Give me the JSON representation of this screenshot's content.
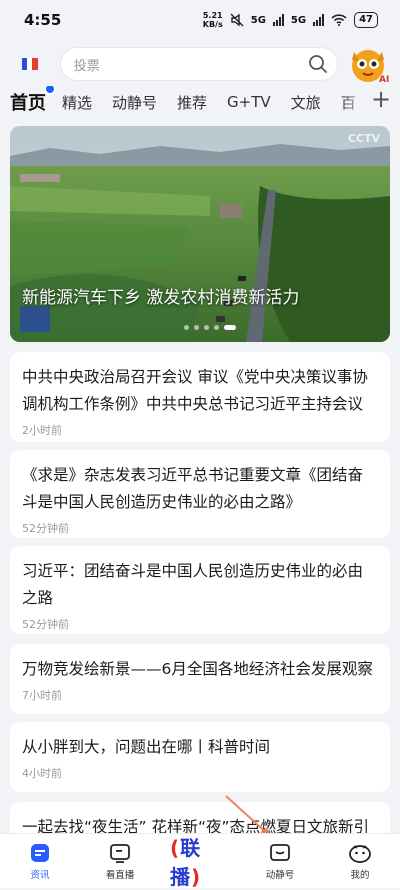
{
  "status_bar": {
    "time": "4:55",
    "net_speed_value": "5.21",
    "net_speed_unit": "KB/s",
    "sig1": "5G",
    "sig2": "5G",
    "battery": "47"
  },
  "header": {
    "search_placeholder": "投票"
  },
  "tabs": [
    {
      "label": "首页"
    },
    {
      "label": "精选"
    },
    {
      "label": "动静号"
    },
    {
      "label": "推荐"
    },
    {
      "label": "G+TV"
    },
    {
      "label": "文旅"
    },
    {
      "label": "百"
    }
  ],
  "hero": {
    "caption": "新能源汽车下乡 激发农村消费新活力",
    "watermark": "CCTV",
    "dots_count": 5,
    "active_dot": 4
  },
  "news": [
    {
      "title": "中共中央政治局召开会议 审议《党中央决策议事协调机构工作条例》中共中央总书记习近平主持会议",
      "time": "2小时前"
    },
    {
      "title": "《求是》杂志发表习近平总书记重要文章《团结奋斗是中国人民创造历史伟业的必由之路》",
      "time": "52分钟前"
    },
    {
      "title": "习近平：团结奋斗是中国人民创造历史伟业的必由之路",
      "time": "52分钟前"
    },
    {
      "title": "万物竞发绘新景——6月全国各地经济社会发展观察",
      "time": "7小时前"
    },
    {
      "title": "从小胖到大，问题出在哪丨科普时间",
      "time": "4小时前"
    },
    {
      "title": "一起去找“夜生活” 花样新“夜”态点燃夏日文旅新引擎",
      "time": ""
    }
  ],
  "bottom_nav": [
    {
      "label": "资讯",
      "icon": "news-icon"
    },
    {
      "label": "看直播",
      "icon": "tv-icon"
    },
    {
      "label": "联播",
      "icon": "lianbo-logo"
    },
    {
      "label": "动静号",
      "icon": "dongjing-icon"
    },
    {
      "label": "我的",
      "icon": "profile-icon"
    }
  ],
  "colors": {
    "accent": "#2a5cff",
    "background": "#f2f3f7",
    "arrow": "#f0845a"
  }
}
